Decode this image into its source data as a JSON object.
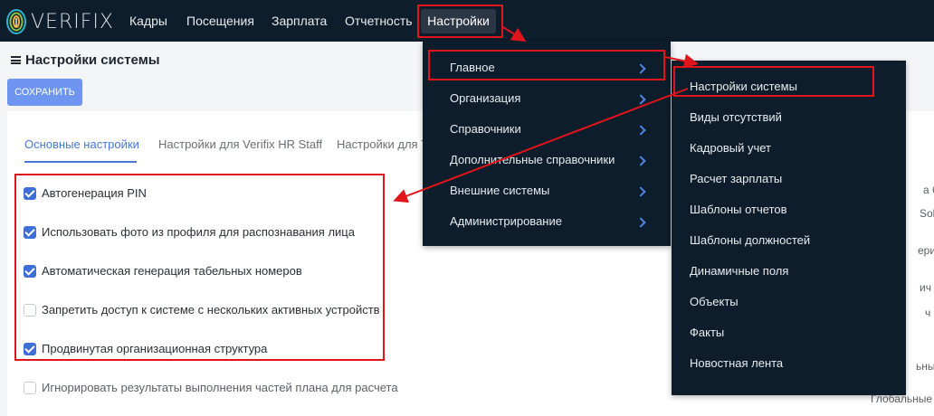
{
  "brand": {
    "logo_text": "VERIFIX"
  },
  "nav": {
    "items": [
      "Кадры",
      "Посещения",
      "Зарплата",
      "Отчетность"
    ],
    "active": "Настройки"
  },
  "page": {
    "title": "Настройки системы",
    "save_label": "СОХРАНИТЬ"
  },
  "tabs": [
    "Основные настройки",
    "Настройки для Verifix HR Staff",
    "Настройки для T"
  ],
  "settings": [
    {
      "label": "Автогенерация PIN",
      "checked": true
    },
    {
      "label": "Использовать фото из профиля для распознавания лица",
      "checked": true
    },
    {
      "label": "Автоматическая генерация табельных номеров",
      "checked": true
    },
    {
      "label": "Запретить доступ к системе с нескольких активных устройств",
      "checked": false
    },
    {
      "label": "Продвинутая организационная структура",
      "checked": true
    },
    {
      "label": "Игнорировать результаты выполнения частей плана для расчета",
      "checked": false
    }
  ],
  "menu_main": [
    "Главное",
    "Организация",
    "Справочники",
    "Дополнительные справочники",
    "Внешние системы",
    "Администрирование"
  ],
  "menu_sub": [
    "Настройки системы",
    "Виды отсутствий",
    "Кадровый учет",
    "Расчет зарплаты",
    "Шаблоны отчетов",
    "Шаблоны должностей",
    "Динамичные поля",
    "Объекты",
    "Факты",
    "Новостная лента"
  ],
  "right_fragments": [
    "а бе",
    "Solo",
    "ери",
    "ич",
    "ч",
    "ьны",
    "Глобальные"
  ],
  "colors": {
    "topbar": "#0e1d2b",
    "accent": "#4a78d8",
    "highlight": "#e0151c"
  }
}
